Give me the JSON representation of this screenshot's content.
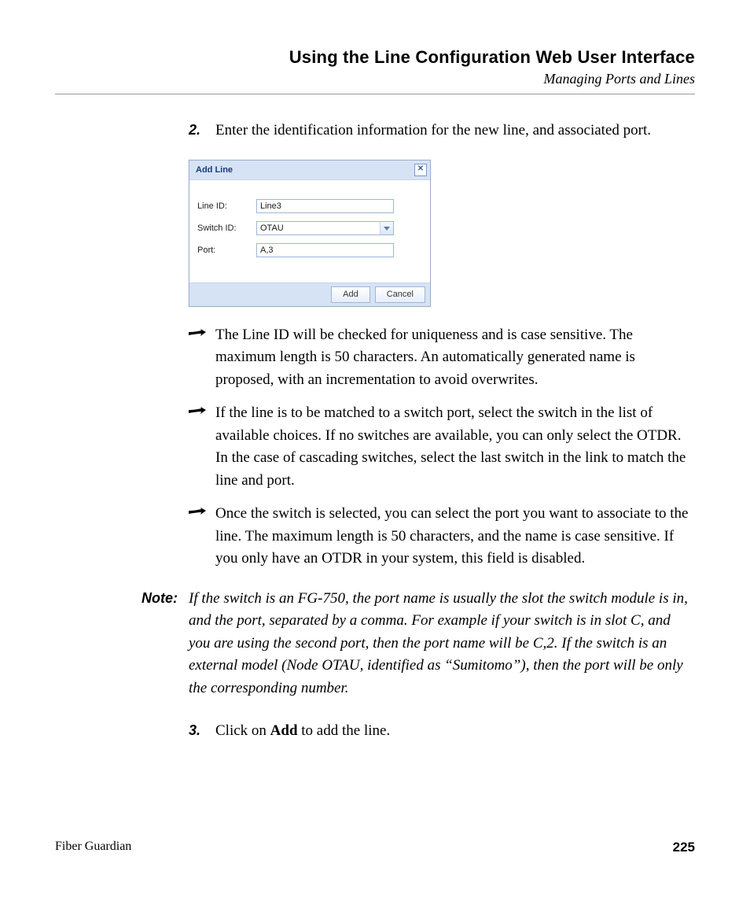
{
  "header": {
    "title": "Using the Line Configuration Web User Interface",
    "subtitle": "Managing Ports and Lines"
  },
  "step2": {
    "num": "2.",
    "text": "Enter the identification information for the new line, and associated port."
  },
  "dialog": {
    "title": "Add Line",
    "fields": {
      "line_id": {
        "label": "Line ID:",
        "value": "Line3"
      },
      "switch_id": {
        "label": "Switch ID:",
        "value": "OTAU"
      },
      "port": {
        "label": "Port:",
        "value": "A,3"
      }
    },
    "buttons": {
      "add": "Add",
      "cancel": "Cancel"
    }
  },
  "bullets": [
    "The Line ID will be checked for uniqueness and is case sensitive. The maximum length is 50 characters. An automatically generated name is proposed, with an incrementation to avoid overwrites.",
    "If the line is to be matched to a switch port, select the switch in the list of available choices. If no switches are available, you can only select the OTDR. In the case of cascading switches, select the last switch in the link to match the line and port.",
    "Once the switch is selected, you can select the port you want to associate to the line. The maximum length is 50 characters, and the name is case sensitive. If you only have an OTDR in your system, this field is disabled."
  ],
  "note": {
    "label": "Note:",
    "text": "If the switch is an FG-750, the port name is usually the slot the switch module is in, and the port, separated by a comma. For example if your switch is in slot C, and you are using the second port, then the port name will be C,2. If the switch is an external model (Node OTAU, identified as “Sumitomo”), then the port will be only the corresponding number."
  },
  "step3": {
    "num": "3.",
    "prefix": "Click on ",
    "bold": "Add",
    "suffix": " to add the line."
  },
  "footer": {
    "product": "Fiber Guardian",
    "page": "225"
  }
}
